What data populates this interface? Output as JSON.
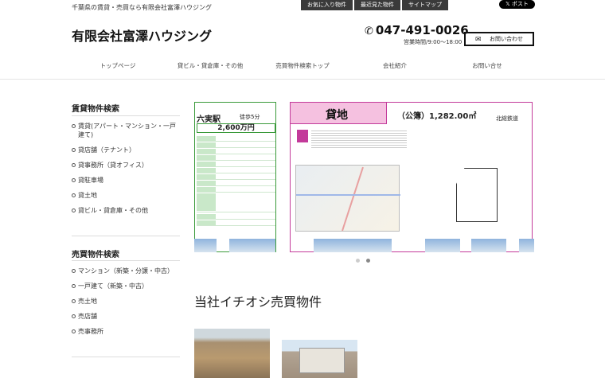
{
  "header": {
    "tagline": "千葉県の賃貸・売買なら有限会社富澤ハウジング",
    "top_links": [
      "お気に入り物件",
      "最近見た物件",
      "サイトマップ"
    ],
    "x_post": "ポスト",
    "logo": "有限会社富澤ハウジング",
    "phone": "047-491-0026",
    "hours": "営業時間/9:00～18:00",
    "contact": "お問い合わせ"
  },
  "nav": [
    "トップページ",
    "貸ビル・貸倉庫・その他",
    "売買物件検索トップ",
    "会社紹介",
    "お問い合せ"
  ],
  "sidebar": {
    "rent_heading": "賃貸物件検索",
    "rent_items": [
      "賃貸(アパート・マンション・一戸建て)",
      "貸店舗（テナント）",
      "貸事務所（貸オフィス）",
      "貸駐車場",
      "貸土地",
      "貸ビル・貸倉庫・その他"
    ],
    "sale_heading": "売買物件検索",
    "sale_items": [
      "マンション（新築・分譲・中古）",
      "一戸建て（新築・中古）",
      "売土地",
      "売店舗",
      "売事務所"
    ]
  },
  "slider": {
    "left": {
      "station": "六実駅",
      "walk": "徒歩5分",
      "price": "2,600万円"
    },
    "main": {
      "title": "貸地",
      "area": "（公簿）1,282.00㎡",
      "rail": "北総鉄道"
    }
  },
  "featured_title": "当社イチオシ売買物件",
  "colors": {
    "green": "#3a9a3a",
    "pink": "#c33a9a",
    "pink_light": "#f5c1e0"
  }
}
